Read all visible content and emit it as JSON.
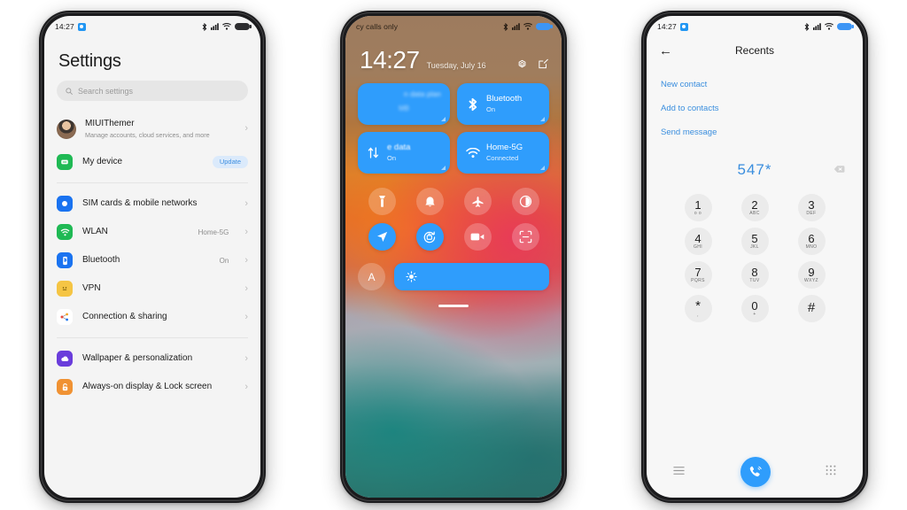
{
  "settings_phone": {
    "status_bar": {
      "time": "14:27",
      "app_icon": "app-badge-icon",
      "icons": [
        "bluetooth-icon",
        "signal-icon",
        "wifi-icon",
        "battery-icon"
      ]
    },
    "page_title": "Settings",
    "search": {
      "placeholder": "Search settings",
      "icon": "search-icon"
    },
    "account": {
      "name": "MIUIThemer",
      "subtitle": "Manage accounts, cloud services, and more",
      "avatar": "user-avatar"
    },
    "items": [
      {
        "label": "My device",
        "value": "",
        "badge": "Update",
        "icon": "device-icon",
        "color": "#1fb954",
        "chevron": false
      },
      {
        "label": "SIM cards & mobile networks",
        "value": "",
        "badge": "",
        "icon": "sim-icon",
        "color": "#1a73f0",
        "chevron": true
      },
      {
        "label": "WLAN",
        "value": "Home-5G",
        "badge": "",
        "icon": "wifi-icon",
        "color": "#1fb954",
        "chevron": true
      },
      {
        "label": "Bluetooth",
        "value": "On",
        "badge": "",
        "icon": "bluetooth-icon",
        "color": "#1a73f0",
        "chevron": true
      },
      {
        "label": "VPN",
        "value": "",
        "badge": "",
        "icon": "vpn-icon",
        "color": "#f5c544",
        "chevron": true
      },
      {
        "label": "Connection & sharing",
        "value": "",
        "badge": "",
        "icon": "share-icon",
        "color": "#ffffff",
        "chevron": true
      },
      {
        "label": "Wallpaper & personalization",
        "value": "",
        "badge": "",
        "icon": "wallpaper-icon",
        "color": "#6a3ddb",
        "chevron": true
      },
      {
        "label": "Always-on display & Lock screen",
        "value": "",
        "badge": "",
        "icon": "lock-icon",
        "color": "#f09233",
        "chevron": true
      }
    ]
  },
  "control_center_phone": {
    "status_bar": {
      "carrier_text": "cy calls only",
      "icons": [
        "bluetooth-icon",
        "signal-icon",
        "wifi-icon",
        "battery-icon"
      ]
    },
    "clock": {
      "time": "14:27",
      "date": "Tuesday, July 16"
    },
    "header_icons": [
      "settings-gear-icon",
      "edit-icon"
    ],
    "tiles": [
      {
        "name": "n data plan",
        "sub": "MB",
        "icon": "data-plan-icon",
        "active": true,
        "blurred": true
      },
      {
        "name": "Bluetooth",
        "sub": "On",
        "icon": "bluetooth-icon",
        "active": true,
        "blurred": false
      },
      {
        "name": "e data",
        "sub": "On",
        "icon": "mobile-data-icon",
        "active": true,
        "blurred": false
      },
      {
        "name": "Home-5G",
        "sub": "Connected",
        "icon": "wifi-icon",
        "active": true,
        "blurred": false
      }
    ],
    "toggles": [
      {
        "icon": "flashlight-icon",
        "active": false
      },
      {
        "icon": "ringer-bell-icon",
        "active": false
      },
      {
        "icon": "airplane-mode-icon",
        "active": false
      },
      {
        "icon": "dark-mode-icon",
        "active": false
      },
      {
        "icon": "location-icon",
        "active": true
      },
      {
        "icon": "auto-rotate-icon",
        "active": true
      },
      {
        "icon": "screen-record-icon",
        "active": false
      },
      {
        "icon": "scanner-icon",
        "active": false
      }
    ],
    "brightness": {
      "auto_label": "A",
      "icon": "brightness-sun-icon",
      "level_percent": 100
    },
    "handle": "drag-handle"
  },
  "dialer_phone": {
    "status_bar": {
      "time": "14:27",
      "app_icon": "app-badge-icon"
    },
    "title": "Recents",
    "back_icon": "back-arrow-icon",
    "actions": [
      "New contact",
      "Add to contacts",
      "Send message"
    ],
    "dialed_number": "547*",
    "backspace_icon": "backspace-icon",
    "keys": [
      {
        "digit": "1",
        "letters": "o o"
      },
      {
        "digit": "2",
        "letters": "ABC"
      },
      {
        "digit": "3",
        "letters": "DEF"
      },
      {
        "digit": "4",
        "letters": "GHI"
      },
      {
        "digit": "5",
        "letters": "JKL"
      },
      {
        "digit": "6",
        "letters": "MNO"
      },
      {
        "digit": "7",
        "letters": "PQRS"
      },
      {
        "digit": "8",
        "letters": "TUV"
      },
      {
        "digit": "9",
        "letters": "WXYZ"
      },
      {
        "digit": "*",
        "letters": ","
      },
      {
        "digit": "0",
        "letters": "+"
      },
      {
        "digit": "#",
        "letters": ""
      }
    ],
    "bottom_bar": {
      "menu_icon": "menu-lines-icon",
      "call_icon": "call-phone-icon",
      "keypad_icon": "keypad-grid-icon"
    }
  },
  "theme": {
    "accent_blue": "#2f9dfc",
    "link_blue": "#3a8ede",
    "settings_bg": "#f4f4f4",
    "dialer_bg": "#f7f7f7",
    "frame": "#1b1b1d"
  }
}
